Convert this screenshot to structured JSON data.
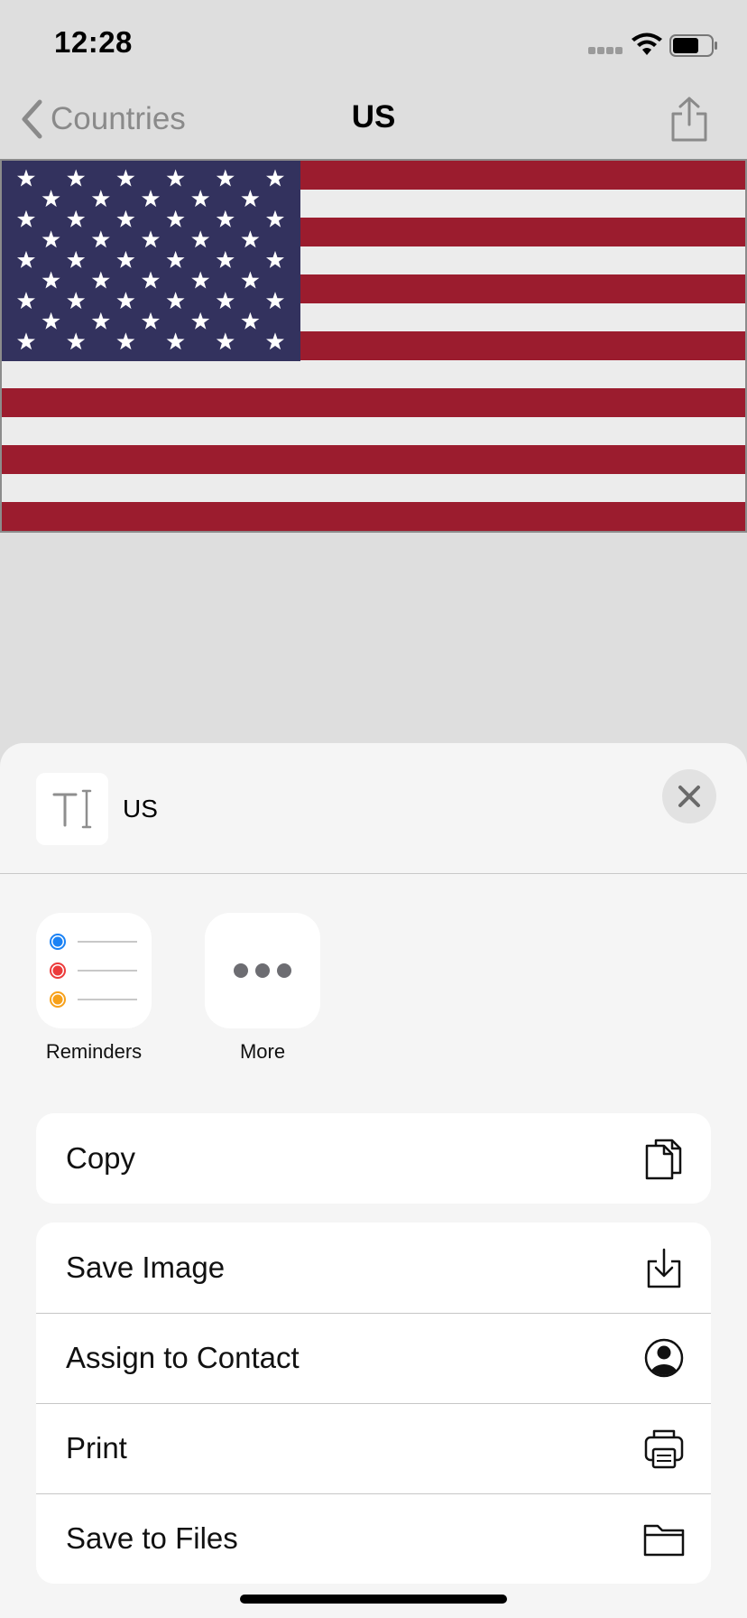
{
  "status_bar": {
    "time": "12:28"
  },
  "nav": {
    "back_label": "Countries",
    "title": "US"
  },
  "flag": {
    "country": "US",
    "stripes": 13,
    "stars": 50,
    "colors": {
      "red": "#9b1c2e",
      "white": "#ececec",
      "blue": "#33325e"
    }
  },
  "share_sheet": {
    "preview_title": "US",
    "apps": [
      {
        "label": "Reminders",
        "icon": "reminders-icon"
      },
      {
        "label": "More",
        "icon": "more-icon"
      }
    ],
    "copy_label": "Copy",
    "actions": [
      {
        "label": "Save Image",
        "icon": "save-image-icon"
      },
      {
        "label": "Assign to Contact",
        "icon": "contact-icon"
      },
      {
        "label": "Print",
        "icon": "printer-icon"
      },
      {
        "label": "Save to Files",
        "icon": "folder-icon"
      }
    ]
  },
  "colors": {
    "background": "#dedede",
    "sheet": "#f5f5f5",
    "secondary_text": "#8a8a8a"
  }
}
